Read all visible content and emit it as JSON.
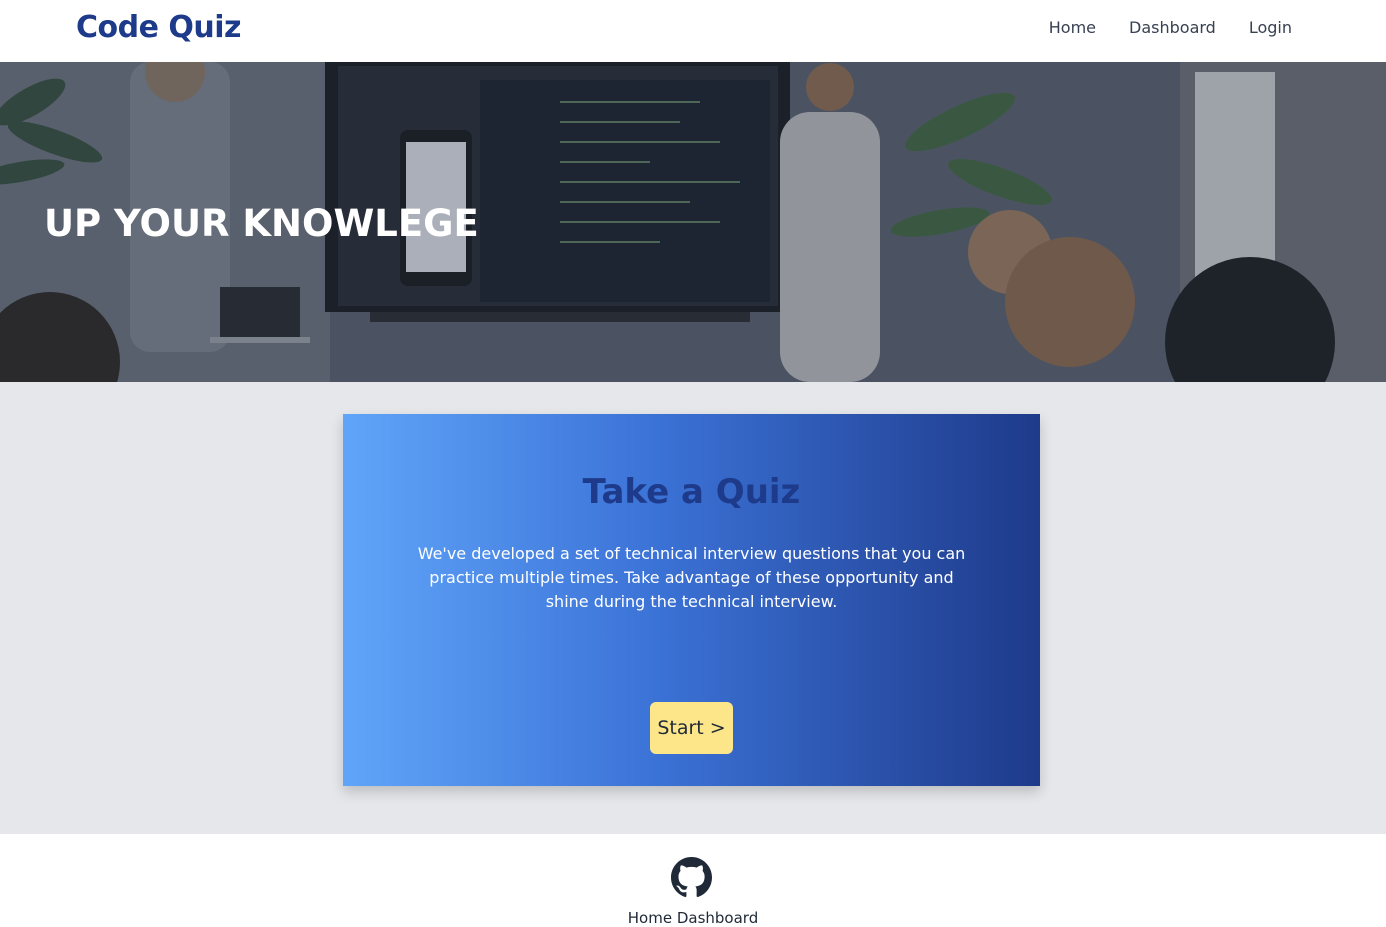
{
  "navbar": {
    "brand": "Code Quiz",
    "links": [
      "Home",
      "Dashboard",
      "Login"
    ]
  },
  "hero": {
    "title": "UP YOUR KNOWLEGE"
  },
  "card": {
    "title": "Take a Quiz",
    "text": "We've developed a set of technical interview questions that you can practice multiple times. Take advantage of these opportunity and shine during the technical interview.",
    "button": "Start >"
  },
  "footer": {
    "icon": "github-icon",
    "link_home": "Home",
    "link_dashboard": "Dashboard"
  },
  "colors": {
    "brand": "#1e3a8a",
    "card_gradient_start": "#60a5fa",
    "card_gradient_end": "#1e3a8a",
    "button": "#fde68a",
    "page_bg": "#e5e7eb"
  }
}
